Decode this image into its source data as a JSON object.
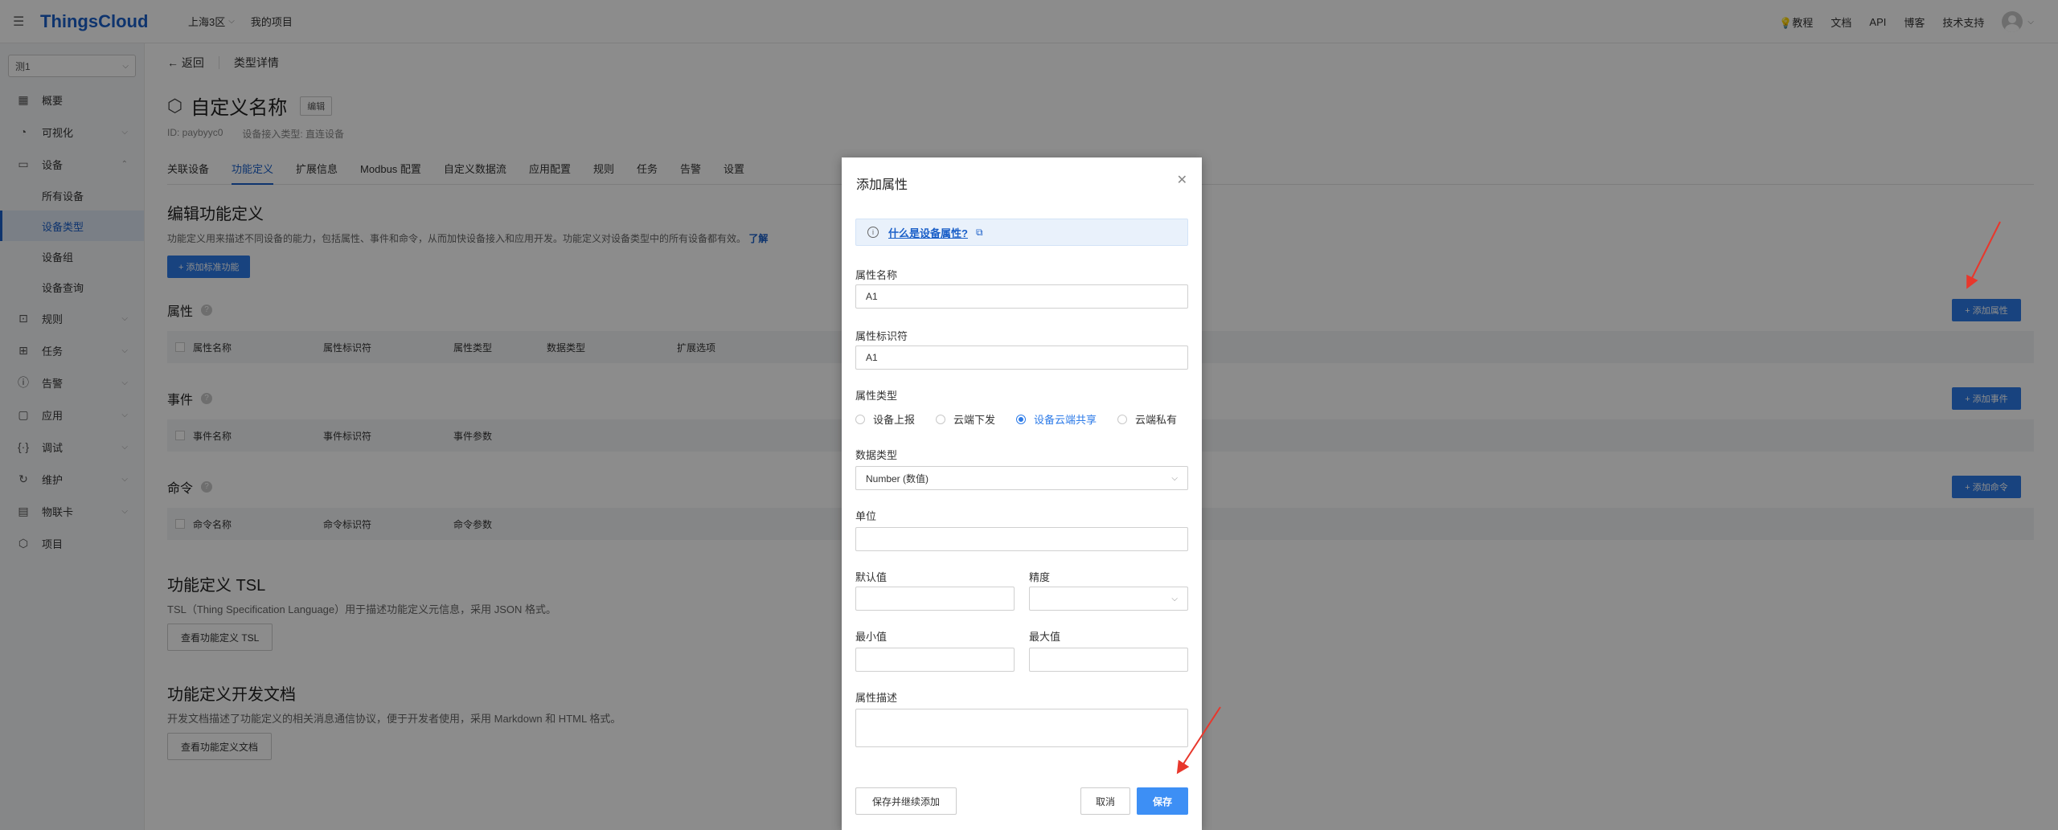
{
  "topbar": {
    "logo": "ThingsCloud",
    "region": "上海3区",
    "my_project": "我的项目",
    "links": [
      "教程",
      "文档",
      "API",
      "博客",
      "技术支持"
    ]
  },
  "sidebar": {
    "project": "测1",
    "items": [
      {
        "label": "概要",
        "icon": "dashboard-icon"
      },
      {
        "label": "可视化",
        "icon": "chart-icon"
      },
      {
        "label": "设备",
        "icon": "device-icon"
      },
      {
        "label": "所有设备"
      },
      {
        "label": "设备类型"
      },
      {
        "label": "设备组"
      },
      {
        "label": "设备查询"
      },
      {
        "label": "规则",
        "icon": "rule-icon"
      },
      {
        "label": "任务",
        "icon": "task-icon"
      },
      {
        "label": "告警",
        "icon": "alert-icon"
      },
      {
        "label": "应用",
        "icon": "app-icon"
      },
      {
        "label": "调试",
        "icon": "debug-icon"
      },
      {
        "label": "维护",
        "icon": "maintain-icon"
      },
      {
        "label": "物联卡",
        "icon": "simcard-icon"
      },
      {
        "label": "项目",
        "icon": "project-icon"
      }
    ]
  },
  "main": {
    "back": "← 返回",
    "crumb": "类型详情",
    "title": "自定义名称",
    "edit": "编辑",
    "id": "ID: paybyyc0",
    "access_type": "设备接入类型: 直连设备",
    "tabs": [
      "关联设备",
      "功能定义",
      "扩展信息",
      "Modbus 配置",
      "自定义数据流",
      "应用配置",
      "规则",
      "任务",
      "告警",
      "设置"
    ],
    "section_title": "编辑功能定义",
    "section_desc": "功能定义用来描述不同设备的能力，包括属性、事件和命令，从而加快设备接入和应用开发。功能定义对设备类型中的所有设备都有效。",
    "section_desc_link": "了解",
    "add_std_btn": "+ 添加标准功能",
    "attr_title": "属性",
    "attr_add": "+ 添加属性",
    "attr_cols": [
      "属性名称",
      "属性标识符",
      "属性类型",
      "数据类型",
      "扩展选项"
    ],
    "event_title": "事件",
    "event_add": "+ 添加事件",
    "event_cols": [
      "事件名称",
      "事件标识符",
      "事件参数"
    ],
    "cmd_title": "命令",
    "cmd_add": "+ 添加命令",
    "cmd_cols": [
      "命令名称",
      "命令标识符",
      "命令参数"
    ],
    "tsl_title": "功能定义 TSL",
    "tsl_desc": "TSL（Thing Specification Language）用于描述功能定义元信息，采用 JSON 格式。",
    "tsl_btn": "查看功能定义 TSL",
    "doc_title": "功能定义开发文档",
    "doc_desc": "开发文档描述了功能定义的相关消息通信协议，便于开发者使用，采用 Markdown 和 HTML 格式。",
    "doc_btn": "查看功能定义文档"
  },
  "modal": {
    "title": "添加属性",
    "info_link": "什么是设备属性?",
    "name_label": "属性名称",
    "name_value": "A1",
    "id_label": "属性标识符",
    "id_value": "A1",
    "type_label": "属性类型",
    "type_options": [
      "设备上报",
      "云端下发",
      "设备云端共享",
      "云端私有"
    ],
    "type_selected": "设备云端共享",
    "dtype_label": "数据类型",
    "dtype_value": "Number (数值)",
    "unit_label": "单位",
    "default_label": "默认值",
    "precision_label": "精度",
    "min_label": "最小值",
    "max_label": "最大值",
    "desc_label": "属性描述",
    "btn_save_continue": "保存并继续添加",
    "btn_cancel": "取消",
    "btn_save": "保存"
  },
  "colors": {
    "brand": "#1a5fc8",
    "primary_button": "#2d7be8",
    "annotation_arrow": "#e8372c"
  }
}
